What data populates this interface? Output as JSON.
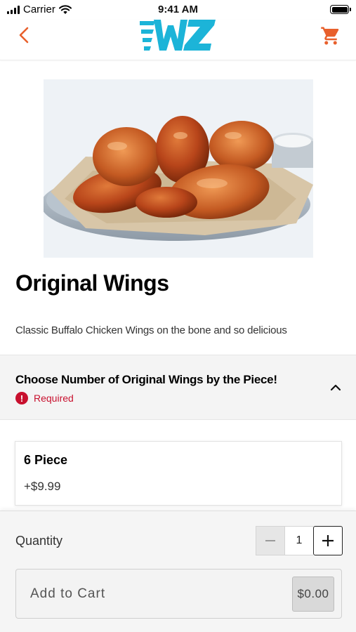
{
  "status_bar": {
    "carrier": "Carrier",
    "time": "9:41 AM"
  },
  "nav": {
    "logo_text": "WZ",
    "accent_color": "#e8602c",
    "logo_color": "#1cb4d8",
    "back_icon": "chevron-left-icon",
    "cart_icon": "shopping-cart-icon"
  },
  "product": {
    "title": "Original Wings",
    "description": "Classic Buffalo Chicken Wings on the bone and so delicious"
  },
  "option_group": {
    "title": "Choose Number of Original Wings by the Piece!",
    "required_label": "Required",
    "required_icon": "!",
    "required_color": "#c8102e",
    "options": [
      {
        "name": "6 Piece",
        "price": "+$9.99"
      }
    ]
  },
  "footer": {
    "quantity_label": "Quantity",
    "quantity_value": "1",
    "add_to_cart_label": "Add to Cart",
    "cart_total": "$0.00"
  }
}
